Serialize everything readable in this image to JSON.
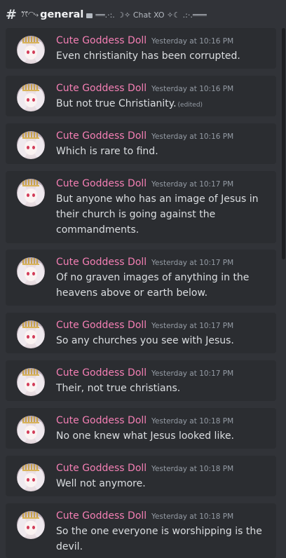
{
  "header": {
    "hash": "#",
    "channel_glyph": "ꔫ◜◝⤷",
    "channel_name": "general",
    "topic": "══.·:. ☽✧ Chat XO ✧☾ .:·.═══"
  },
  "messages": [
    {
      "author": "Cute Goddess Doll",
      "timestamp": "Yesterday at 10:16 PM",
      "text": "Even christianity has been corrupted.",
      "edited": ""
    },
    {
      "author": "Cute Goddess Doll",
      "timestamp": "Yesterday at 10:16 PM",
      "text": "But not true Christianity.",
      "edited": "(edited)"
    },
    {
      "author": "Cute Goddess Doll",
      "timestamp": "Yesterday at 10:16 PM",
      "text": "Which is rare to find.",
      "edited": ""
    },
    {
      "author": "Cute Goddess Doll",
      "timestamp": "Yesterday at 10:17 PM",
      "text": "But anyone who has an image of Jesus in their church is going against the commandments.",
      "edited": ""
    },
    {
      "author": "Cute Goddess Doll",
      "timestamp": "Yesterday at 10:17 PM",
      "text": "Of no graven images of anything in the heavens above or earth below.",
      "edited": ""
    },
    {
      "author": "Cute Goddess Doll",
      "timestamp": "Yesterday at 10:17 PM",
      "text": "So any churches you see with Jesus.",
      "edited": ""
    },
    {
      "author": "Cute Goddess Doll",
      "timestamp": "Yesterday at 10:17 PM",
      "text": "Their, not true christians.",
      "edited": ""
    },
    {
      "author": "Cute Goddess Doll",
      "timestamp": "Yesterday at 10:18 PM",
      "text": "No one knew what Jesus looked like.",
      "edited": ""
    },
    {
      "author": "Cute Goddess Doll",
      "timestamp": "Yesterday at 10:18 PM",
      "text": "Well not anymore.",
      "edited": ""
    },
    {
      "author": "Cute Goddess Doll",
      "timestamp": "Yesterday at 10:18 PM",
      "text": "So the one everyone is worshipping is the devil.",
      "edited": ""
    }
  ]
}
